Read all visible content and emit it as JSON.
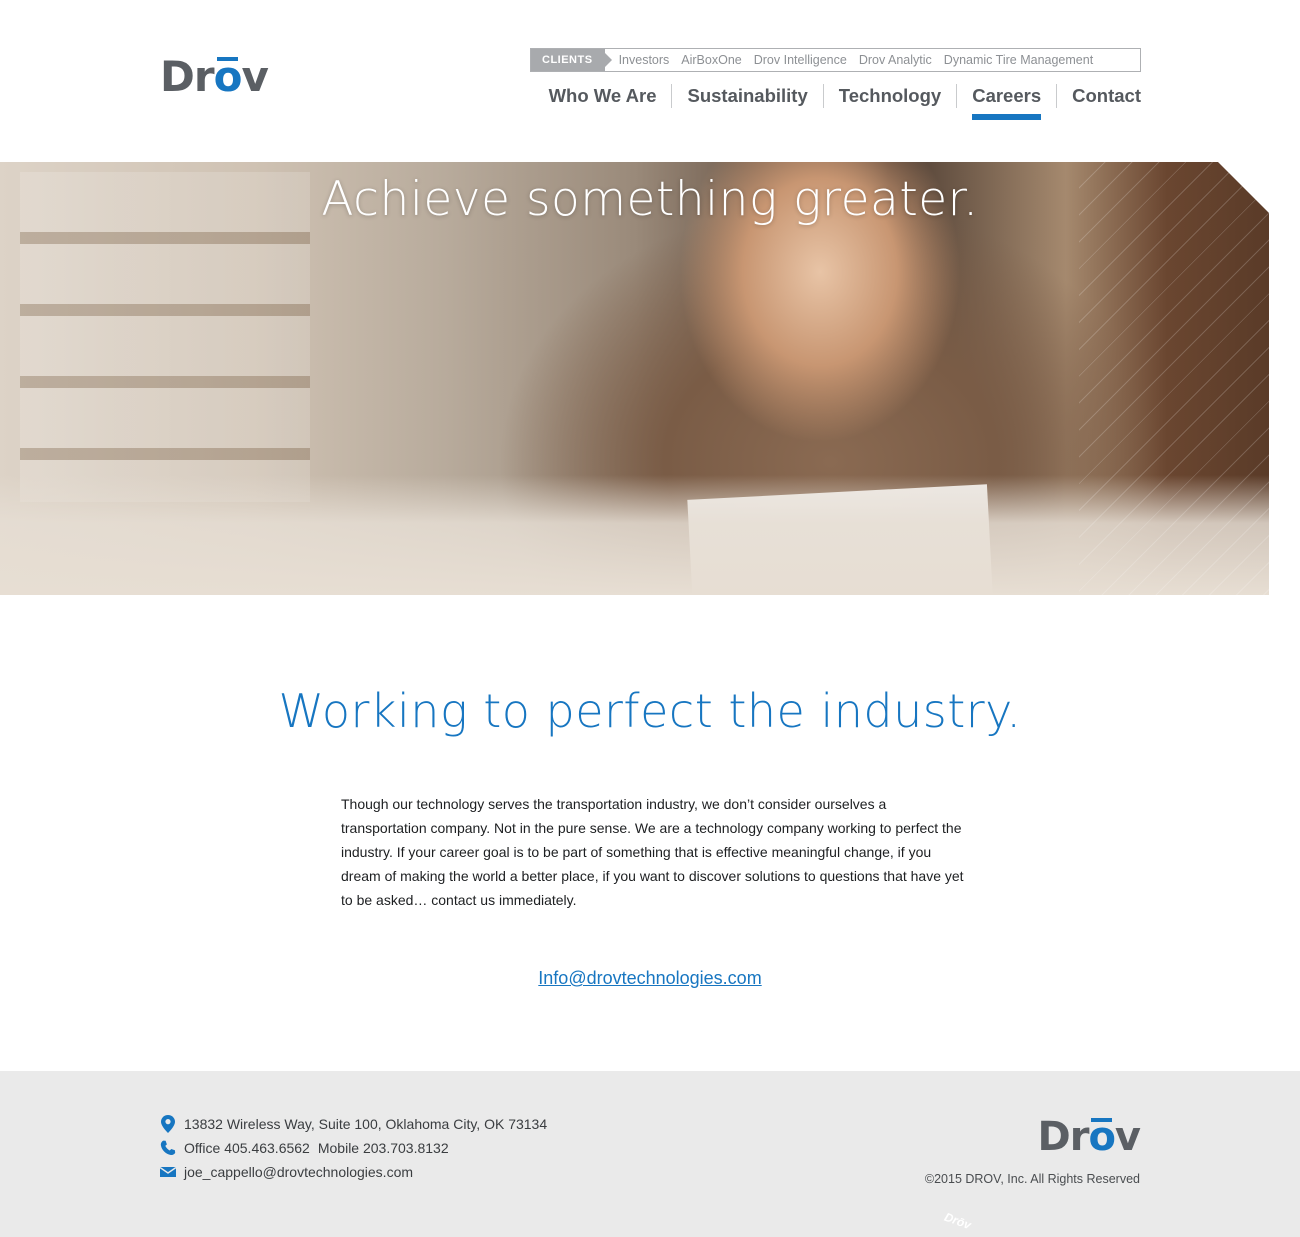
{
  "brand": {
    "logo_text": "Drōv",
    "logo_pre": "Dr",
    "logo_o": "o",
    "logo_post": "v",
    "accent_color": "#1776c1",
    "gray_color": "#5b5f64"
  },
  "clients_bar": {
    "tag": "CLIENTS",
    "links": [
      "Investors",
      "AirBoxOne",
      "Drov Intelligence",
      "Drov Analytic",
      "Dynamic Tire Management"
    ]
  },
  "nav": {
    "items": [
      "Who We Are",
      "Sustainability",
      "Technology",
      "Careers",
      "Contact"
    ],
    "active": "Careers"
  },
  "hero": {
    "title": "Achieve something greater."
  },
  "main": {
    "headline": "Working to perfect the industry.",
    "body": "Though our technology serves the transportation industry, we don’t consider ourselves a transportation company. Not in the pure sense. We are a technology company working to perfect the industry. If your career goal is to be part of something that is effective meaningful change, if you dream of making the world a better place, if you want to discover solutions to questions that have yet to be asked… contact us immediately.",
    "email": "Info@drovtechnologies.com"
  },
  "footer": {
    "address": "13832 Wireless Way, Suite 100, Oklahoma City, OK 73134",
    "office": "Office 405.463.6562",
    "mobile": "Mobile 203.703.8132",
    "email": "joe_cappello@drovtechnologies.com",
    "copyright": "©2015 DROV, Inc. All Rights Reserved",
    "watermark": "Drōv"
  },
  "icons": {
    "location": "map-pin-icon",
    "phone": "phone-icon",
    "mail": "envelope-icon"
  }
}
